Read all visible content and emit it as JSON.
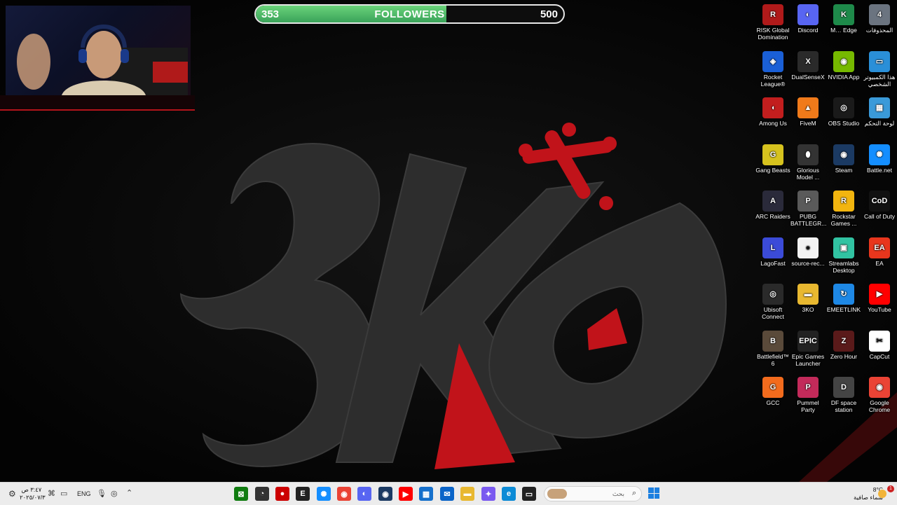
{
  "followers": {
    "current": "353",
    "label": "FOLLOWERS",
    "goal": "500",
    "progress_fraction": 0.62
  },
  "wallpaper": {
    "brand": "3KO"
  },
  "desktop_icons": [
    {
      "label": "RISK Global Domination",
      "icon": "risk-icon",
      "color": "#b01a1a",
      "glyph": "R"
    },
    {
      "label": "Discord",
      "icon": "discord-icon",
      "color": "#5865f2",
      "glyph": "◐"
    },
    {
      "label": "M… Edge",
      "icon": "edge-icon",
      "color": "#1e8a4a",
      "glyph": "K"
    },
    {
      "label": "المحذوفات",
      "icon": "recycle-bin-icon",
      "color": "#6b7480",
      "glyph": "4"
    },
    {
      "label": "Rocket League®",
      "icon": "rocket-league-icon",
      "color": "#1a5fd6",
      "glyph": "◈"
    },
    {
      "label": "DualSenseX",
      "icon": "dualsensex-icon",
      "color": "#2a2a2a",
      "glyph": "X"
    },
    {
      "label": "NVIDIA App",
      "icon": "nvidia-icon",
      "color": "#76b900",
      "glyph": "◉"
    },
    {
      "label": "هذا الكمبيوتر الشخصي",
      "icon": "this-pc-icon",
      "color": "#2a8fd8",
      "glyph": "▭"
    },
    {
      "label": "Among Us",
      "icon": "among-us-icon",
      "color": "#c21e1e",
      "glyph": "◖"
    },
    {
      "label": "FiveM",
      "icon": "fivem-icon",
      "color": "#f07a1a",
      "glyph": "▲"
    },
    {
      "label": "OBS Studio",
      "icon": "obs-icon",
      "color": "#1a1a1a",
      "glyph": "◎"
    },
    {
      "label": "لوحة التحكم",
      "icon": "control-panel-icon",
      "color": "#3a9ad9",
      "glyph": "▦"
    },
    {
      "label": "Gang Beasts",
      "icon": "gang-beasts-icon",
      "color": "#d6c21e",
      "glyph": "G"
    },
    {
      "label": "Glorious Model ...",
      "icon": "glorious-mouse-icon",
      "color": "#333",
      "glyph": "⬮"
    },
    {
      "label": "Steam",
      "icon": "steam-icon",
      "color": "#1b3a63",
      "glyph": "◉"
    },
    {
      "label": "Battle.net",
      "icon": "battlenet-icon",
      "color": "#148eff",
      "glyph": "✺"
    },
    {
      "label": "ARC Raiders",
      "icon": "arc-raiders-icon",
      "color": "#2a2a3a",
      "glyph": "A"
    },
    {
      "label": "PUBG BATTLEGR...",
      "icon": "pubg-icon",
      "color": "#5a5a5a",
      "glyph": "P"
    },
    {
      "label": "Rockstar Games ...",
      "icon": "rockstar-icon",
      "color": "#f2b50f",
      "glyph": "R"
    },
    {
      "label": "Call of Duty",
      "icon": "call-of-duty-icon",
      "color": "#111",
      "glyph": "CoD"
    },
    {
      "label": "LagoFast",
      "icon": "lagofast-icon",
      "color": "#3b4bd8",
      "glyph": "L"
    },
    {
      "label": "source-rec...",
      "icon": "source-record-icon",
      "color": "#f2f2f2",
      "glyph": "●"
    },
    {
      "label": "Streamlabs Desktop",
      "icon": "streamlabs-icon",
      "color": "#31c3a2",
      "glyph": "▣"
    },
    {
      "label": "EA",
      "icon": "ea-icon",
      "color": "#e8361d",
      "glyph": "EA"
    },
    {
      "label": "Ubisoft Connect",
      "icon": "ubisoft-icon",
      "color": "#2a2a2a",
      "glyph": "◎"
    },
    {
      "label": "3KO",
      "icon": "folder-icon",
      "color": "#e8b830",
      "glyph": "▬"
    },
    {
      "label": "EMEETLINK",
      "icon": "emeetlink-icon",
      "color": "#1e88e5",
      "glyph": "↻"
    },
    {
      "label": "YouTube",
      "icon": "youtube-icon",
      "color": "#ff0000",
      "glyph": "▶"
    },
    {
      "label": "Battlefield™ 6",
      "icon": "battlefield-icon",
      "color": "#5a4a3a",
      "glyph": "B"
    },
    {
      "label": "Epic Games Launcher",
      "icon": "epic-games-icon",
      "color": "#222",
      "glyph": "EPIC"
    },
    {
      "label": "Zero Hour",
      "icon": "zero-hour-icon",
      "color": "#5a1a1a",
      "glyph": "Z"
    },
    {
      "label": "CapCut",
      "icon": "capcut-icon",
      "color": "#fff",
      "glyph": "✂"
    },
    {
      "label": "GCC",
      "icon": "gcc-icon",
      "color": "#f26b1d",
      "glyph": "G"
    },
    {
      "label": "Pummel Party",
      "icon": "pummel-party-icon",
      "color": "#c22a5a",
      "glyph": "P"
    },
    {
      "label": "DF space station",
      "icon": "df-space-station-icon",
      "color": "#444",
      "glyph": "D"
    },
    {
      "label": "Google Chrome",
      "icon": "chrome-icon",
      "color": "#ea4335",
      "glyph": "◉"
    }
  ],
  "taskbar": {
    "time": "٣:٤٧ ص",
    "date": "٢٠٢٥/٠٧/٣",
    "language": "ENG",
    "search_placeholder": "بحث",
    "weather_temp": "8°C",
    "weather_desc": "سماء صافية",
    "notification_count": "1",
    "apps": [
      {
        "icon": "xbox-icon",
        "color": "#107c10",
        "glyph": "⊠"
      },
      {
        "icon": "speedometer-icon",
        "color": "#333",
        "glyph": "◔"
      },
      {
        "icon": "record-icon",
        "color": "#c00",
        "glyph": "●"
      },
      {
        "icon": "epic-games-icon",
        "color": "#222",
        "glyph": "E"
      },
      {
        "icon": "battlenet-icon",
        "color": "#148eff",
        "glyph": "✺"
      },
      {
        "icon": "chrome-icon",
        "color": "#ea4335",
        "glyph": "◉"
      },
      {
        "icon": "discord-icon",
        "color": "#5865f2",
        "glyph": "◐"
      },
      {
        "icon": "steam-icon",
        "color": "#1b3a63",
        "glyph": "◉"
      },
      {
        "icon": "youtube-icon",
        "color": "#ff0000",
        "glyph": "▶"
      },
      {
        "icon": "store-icon",
        "color": "#1570cc",
        "glyph": "▦"
      },
      {
        "icon": "outlook-icon",
        "color": "#0a64c8",
        "glyph": "✉"
      },
      {
        "icon": "file-explorer-icon",
        "color": "#e8b830",
        "glyph": "▬"
      },
      {
        "icon": "copilot-icon",
        "color": "#7a5af0",
        "glyph": "✦"
      },
      {
        "icon": "edge-icon",
        "color": "#0c8bd6",
        "glyph": "e"
      },
      {
        "icon": "terminal-icon",
        "color": "#222",
        "glyph": "▭"
      }
    ]
  }
}
